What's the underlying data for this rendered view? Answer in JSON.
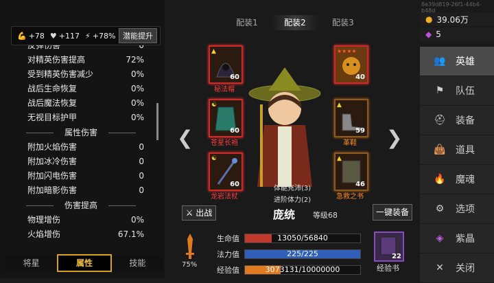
{
  "session_id": "8e39d819-26f1-44b4-b48d",
  "bonus": {
    "attack": "+78",
    "health": "+117",
    "speed": "+78%",
    "boost_label": "潜能提升"
  },
  "stats_top": [
    {
      "label": "反弹伤害",
      "value": "0"
    },
    {
      "label": "对精英伤害提高",
      "value": "72%"
    },
    {
      "label": "受到精英伤害减少",
      "value": "0%"
    },
    {
      "label": "战后生命恢复",
      "value": "0%"
    },
    {
      "label": "战后魔法恢复",
      "value": "0%"
    },
    {
      "label": "无视目标护甲",
      "value": "0%"
    }
  ],
  "section_attr": "属性伤害",
  "stats_attr": [
    {
      "label": "附加火焰伤害",
      "value": "0"
    },
    {
      "label": "附加冰冷伤害",
      "value": "0"
    },
    {
      "label": "附加闪电伤害",
      "value": "0"
    },
    {
      "label": "附加暗影伤害",
      "value": "0"
    }
  ],
  "section_dmg": "伤害提高",
  "stats_dmg": [
    {
      "label": "物理增伤",
      "value": "0%"
    },
    {
      "label": "火焰增伤",
      "value": "67.1%"
    }
  ],
  "bottom_tabs": [
    "将星",
    "属性",
    "技能"
  ],
  "outfit_tabs": [
    "配装1",
    "配装2",
    "配装3"
  ],
  "slots": {
    "hat": {
      "name": "秘法帽",
      "level": "60"
    },
    "robe": {
      "name": "苍星长袍",
      "level": "60"
    },
    "staff": {
      "name": "龙岩法杖",
      "level": "60"
    },
    "pet": {
      "level": "40"
    },
    "shoes": {
      "name": "革鞋",
      "level": "59"
    },
    "book": {
      "name": "急救之书",
      "level": "46"
    }
  },
  "buffs": [
    "体能充沛(3)",
    "进阶体力(2)"
  ],
  "hero": {
    "name": "庞统",
    "level_label": "等级68",
    "battle_label": "出战",
    "equip_label": "一键装备"
  },
  "bars": [
    {
      "label": "生命值",
      "text": "13050/56840",
      "fraction": 0.23,
      "color": "#c0392b"
    },
    {
      "label": "法力值",
      "text": "225/225",
      "fraction": 1.0,
      "color": "#2f5fb8"
    },
    {
      "label": "经验值",
      "text": "3073131/10000000",
      "fraction": 0.31,
      "color": "#e07a1f"
    }
  ],
  "stamina": "75%",
  "exp_book": {
    "count": "22",
    "label": "经验书"
  },
  "currency": {
    "gold": "39.06万",
    "gem": "5"
  },
  "nav": [
    "英雄",
    "队伍",
    "装备",
    "道具",
    "魔魂",
    "选项",
    "紫晶",
    "关闭"
  ]
}
